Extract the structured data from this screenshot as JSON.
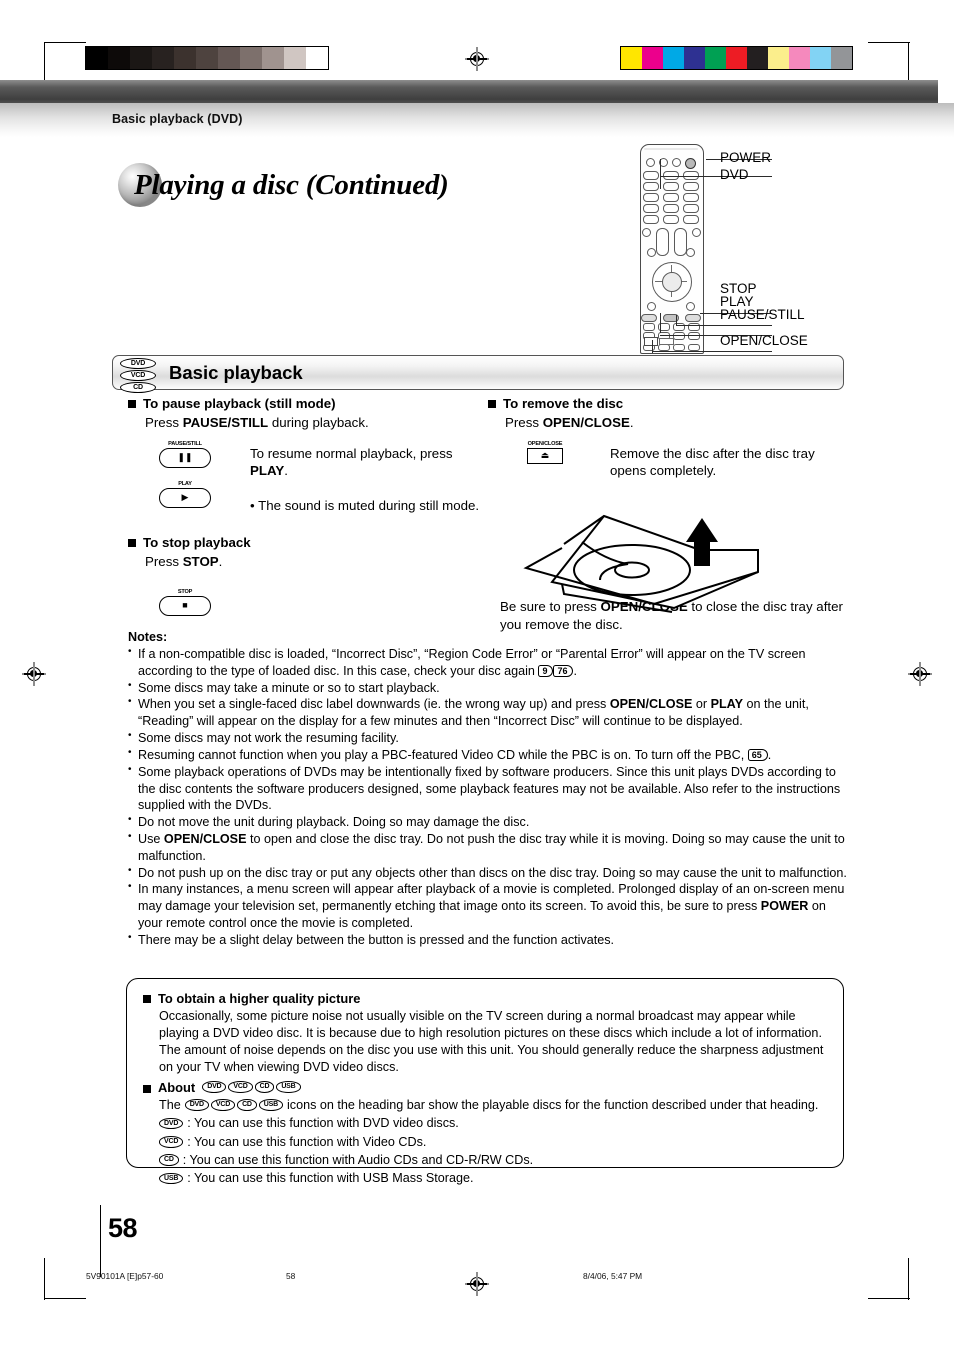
{
  "breadcrumb": "Basic playback (DVD)",
  "title": "Playing a disc (Continued)",
  "remote": {
    "labels": [
      "POWER",
      "DVD",
      "STOP",
      "PLAY",
      "PAUSE/STILL",
      "OPEN/CLOSE"
    ]
  },
  "heading": {
    "text": "Basic playback",
    "discs": [
      "DVD",
      "VCD",
      "CD"
    ]
  },
  "left_column": {
    "pause": {
      "title": "To pause playback (still mode)",
      "line_prefix": "Press ",
      "line_bold": "PAUSE/STILL",
      "line_suffix": " during playback.",
      "button_cap": "PAUSE/STILL",
      "button_glyph": "❚❚",
      "resume_prefix": "To resume normal playback, press ",
      "resume_bold": "PLAY",
      "resume_suffix": ".",
      "play_cap": "PLAY",
      "play_glyph": "▶",
      "bullet": "• The sound is muted during still mode."
    },
    "stop": {
      "title": "To stop playback",
      "line_prefix": "Press ",
      "line_bold": "STOP",
      "line_suffix": ".",
      "button_cap": "STOP",
      "button_glyph": "■"
    }
  },
  "right_column": {
    "remove": {
      "title": "To remove the disc",
      "line_prefix": "Press ",
      "line_bold": "OPEN/CLOSE",
      "line_suffix": ".",
      "button_cap": "OPEN/CLOSE",
      "button_glyph": "⏏",
      "note": "Remove the disc after the disc tray opens completely.",
      "footer_prefix": "Be sure to press ",
      "footer_bold": "OPEN/CLOSE",
      "footer_suffix": " to close the disc tray after you remove the disc."
    }
  },
  "notes": {
    "heading": "Notes:",
    "items": [
      {
        "segments": [
          {
            "t": "If a non-compatible disc is loaded, “Incorrect Disc”, “Region Code Error” or “Parental Error” will appear on the TV screen according to the type of loaded disc. In this case, check your disc again "
          },
          {
            "t": "9",
            "style": "pageref"
          },
          {
            "t": "76",
            "style": "pageref"
          },
          {
            "t": "."
          }
        ]
      },
      {
        "segments": [
          {
            "t": "Some discs may take a minute or so to start playback."
          }
        ]
      },
      {
        "segments": [
          {
            "t": "When you set a single-faced disc label downwards (ie. the wrong way up) and press "
          },
          {
            "t": "OPEN/CLOSE",
            "style": "bold"
          },
          {
            "t": " or "
          },
          {
            "t": "PLAY",
            "style": "bold"
          },
          {
            "t": " on the unit, “Reading” will appear on the display for a few minutes and then “Incorrect Disc” will continue to be displayed."
          }
        ]
      },
      {
        "segments": [
          {
            "t": "Some discs may not work the resuming facility."
          }
        ]
      },
      {
        "segments": [
          {
            "t": "Resuming cannot function when you play a PBC-featured Video CD while the PBC is on. To turn off the PBC, "
          },
          {
            "t": "65",
            "style": "pageref"
          },
          {
            "t": "."
          }
        ]
      },
      {
        "segments": [
          {
            "t": "Some playback operations of DVDs may be intentionally fixed by software producers. Since this unit plays DVDs according to the disc contents the software producers designed, some playback features may not be available. Also refer to the instructions supplied with the DVDs."
          }
        ]
      },
      {
        "segments": [
          {
            "t": "Do not move the unit during playback. Doing so may damage the disc."
          }
        ]
      },
      {
        "segments": [
          {
            "t": "Use "
          },
          {
            "t": "OPEN/CLOSE",
            "style": "bold"
          },
          {
            "t": " to open and close the disc tray. Do not push the disc tray while it is moving. Doing so may cause the unit to malfunction."
          }
        ]
      },
      {
        "segments": [
          {
            "t": "Do not push up on the disc tray or put any objects other than discs on the disc tray. Doing so may cause the unit to malfunction."
          }
        ]
      },
      {
        "segments": [
          {
            "t": "In many instances, a menu screen will appear after playback of a movie is completed. Prolonged display of an on-screen menu may damage your television set, permanently etching that image onto its screen. To avoid this, be sure to press "
          },
          {
            "t": "POWER",
            "style": "bold"
          },
          {
            "t": " on your remote control once the movie is completed."
          }
        ]
      },
      {
        "segments": [
          {
            "t": "There may be a slight delay between the button is pressed and the function activates."
          }
        ]
      }
    ]
  },
  "quality_box": {
    "title": "To obtain a higher quality picture",
    "body": "Occasionally, some picture noise not usually visible on the TV screen during a normal broadcast may appear while playing a DVD video disc. It is because due to high resolution pictures on these discs which include a lot of information. The amount of noise depends on the disc you use with this unit. You should generally reduce the sharpness adjustment on your TV when viewing DVD video discs.",
    "about_label": "About",
    "about_discs": [
      "DVD",
      "VCD",
      "CD",
      "USB"
    ],
    "about_line_prefix": "The",
    "about_line_suffix": "icons on the heading bar show the playable discs for the function described under that heading.",
    "disc_items": [
      {
        "icon": "DVD",
        "text": ": You can use this function with DVD video discs."
      },
      {
        "icon": "VCD",
        "text": ": You can use this function with Video CDs."
      },
      {
        "icon": "CD",
        "text": ": You can use this function with Audio CDs and CD-R/RW CDs."
      },
      {
        "icon": "USB",
        "text": ": You can use this function with USB Mass Storage."
      }
    ]
  },
  "footer": {
    "page_number": "58",
    "job_code": "5V90101A [E]p57-60",
    "center_page": "58",
    "timestamp": "8/4/06, 5:47 PM"
  },
  "calibration": {
    "grayscale": [
      "#000000",
      "#0d0a09",
      "#1b1715",
      "#282220",
      "#3c322e",
      "#4e433f",
      "#645754",
      "#7d706c",
      "#a0938f",
      "#d0c6c2",
      "#ffffff"
    ],
    "colors": [
      "#ffe600",
      "#ec008c",
      "#00a9e6",
      "#2e3192",
      "#00a053",
      "#ed1c24",
      "#231f20",
      "#fbee8c",
      "#f589bd",
      "#82d3f4",
      "#939598"
    ]
  }
}
